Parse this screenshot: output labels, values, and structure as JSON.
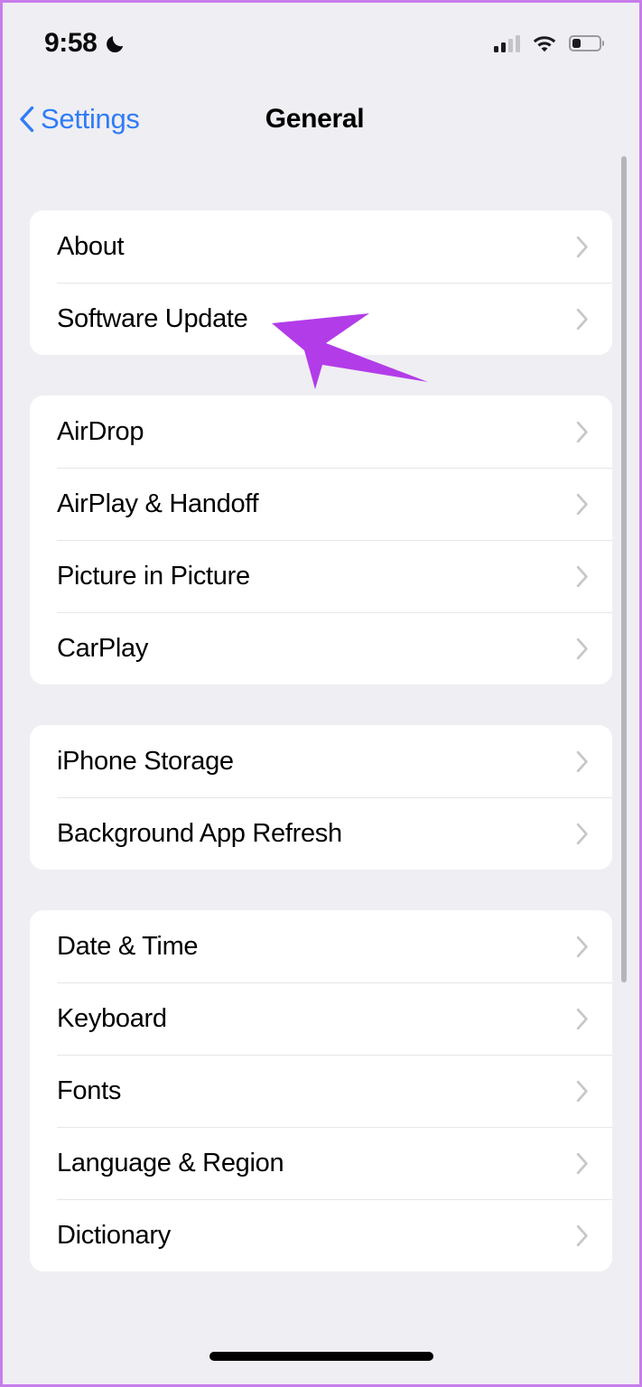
{
  "status_bar": {
    "time": "9:58",
    "focus_icon": "moon-icon",
    "cellular_icon": "signal-bars-icon",
    "cellular_bars_filled": 2,
    "cellular_bars_total": 4,
    "wifi_icon": "wifi-icon",
    "battery_icon": "battery-icon",
    "battery_level_percent": 32
  },
  "nav": {
    "back_label": "Settings",
    "back_icon": "chevron-left-icon",
    "title": "General"
  },
  "colors": {
    "accent_blue": "#2F7CF6",
    "annotation_purple": "#B23CE8",
    "background": "#EFEEF3",
    "card": "#FFFFFF",
    "separator": "#E6E6E9",
    "chevron": "#C7C7CC",
    "frame": "#C77DEB"
  },
  "groups": [
    {
      "id": "group-system",
      "rows": [
        {
          "label": "About",
          "accessory": "chevron-right-icon"
        },
        {
          "label": "Software Update",
          "accessory": "chevron-right-icon"
        }
      ]
    },
    {
      "id": "group-connectivity",
      "rows": [
        {
          "label": "AirDrop",
          "accessory": "chevron-right-icon"
        },
        {
          "label": "AirPlay & Handoff",
          "accessory": "chevron-right-icon"
        },
        {
          "label": "Picture in Picture",
          "accessory": "chevron-right-icon"
        },
        {
          "label": "CarPlay",
          "accessory": "chevron-right-icon"
        }
      ]
    },
    {
      "id": "group-storage",
      "rows": [
        {
          "label": "iPhone Storage",
          "accessory": "chevron-right-icon"
        },
        {
          "label": "Background App Refresh",
          "accessory": "chevron-right-icon"
        }
      ]
    },
    {
      "id": "group-localization",
      "rows": [
        {
          "label": "Date & Time",
          "accessory": "chevron-right-icon"
        },
        {
          "label": "Keyboard",
          "accessory": "chevron-right-icon"
        },
        {
          "label": "Fonts",
          "accessory": "chevron-right-icon"
        },
        {
          "label": "Language & Region",
          "accessory": "chevron-right-icon"
        },
        {
          "label": "Dictionary",
          "accessory": "chevron-right-icon"
        }
      ]
    }
  ],
  "annotation": {
    "icon": "arrow-pointer-icon",
    "points_at": "Software Update",
    "color": "#B23CE8"
  },
  "home_indicator": {
    "icon": "home-indicator-bar"
  }
}
